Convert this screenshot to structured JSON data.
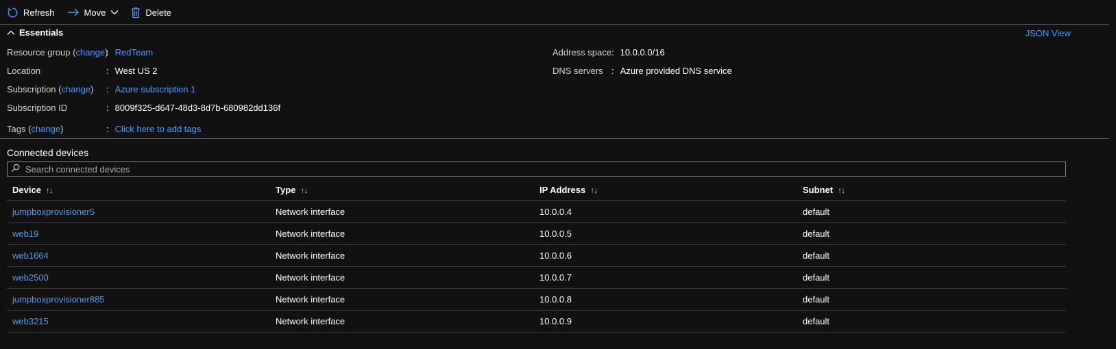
{
  "toolbar": {
    "refresh_label": "Refresh",
    "move_label": "Move",
    "delete_label": "Delete"
  },
  "essentials": {
    "title": "Essentials",
    "json_view": "JSON View",
    "resource_group": {
      "label": "Resource group",
      "change": "change",
      "value": "RedTeam"
    },
    "location": {
      "label": "Location",
      "value": "West US 2"
    },
    "subscription": {
      "label": "Subscription",
      "change": "change",
      "value": "Azure subscription 1"
    },
    "subscription_id": {
      "label": "Subscription ID",
      "value": "8009f325-d647-48d3-8d7b-680982dd136f"
    },
    "tags": {
      "label": "Tags",
      "change": "change",
      "value": "Click here to add tags"
    },
    "address_space": {
      "label": "Address space",
      "value": "10.0.0.0/16"
    },
    "dns_servers": {
      "label": "DNS servers",
      "value": "Azure provided DNS service"
    }
  },
  "connected_devices": {
    "title": "Connected devices",
    "search_placeholder": "Search connected devices",
    "columns": [
      "Device",
      "Type",
      "IP Address",
      "Subnet"
    ],
    "rows": [
      {
        "device": "jumpboxprovisioner5",
        "type": "Network interface",
        "ip": "10.0.0.4",
        "subnet": "default"
      },
      {
        "device": "web19",
        "type": "Network interface",
        "ip": "10.0.0.5",
        "subnet": "default"
      },
      {
        "device": "web1664",
        "type": "Network interface",
        "ip": "10.0.0.6",
        "subnet": "default"
      },
      {
        "device": "web2500",
        "type": "Network interface",
        "ip": "10.0.0.7",
        "subnet": "default"
      },
      {
        "device": "jumpboxprovisioner885",
        "type": "Network interface",
        "ip": "10.0.0.8",
        "subnet": "default"
      },
      {
        "device": "web3215",
        "type": "Network interface",
        "ip": "10.0.0.9",
        "subnet": "default"
      }
    ]
  },
  "colors": {
    "link": "#4f9bf5",
    "background": "#111111"
  }
}
